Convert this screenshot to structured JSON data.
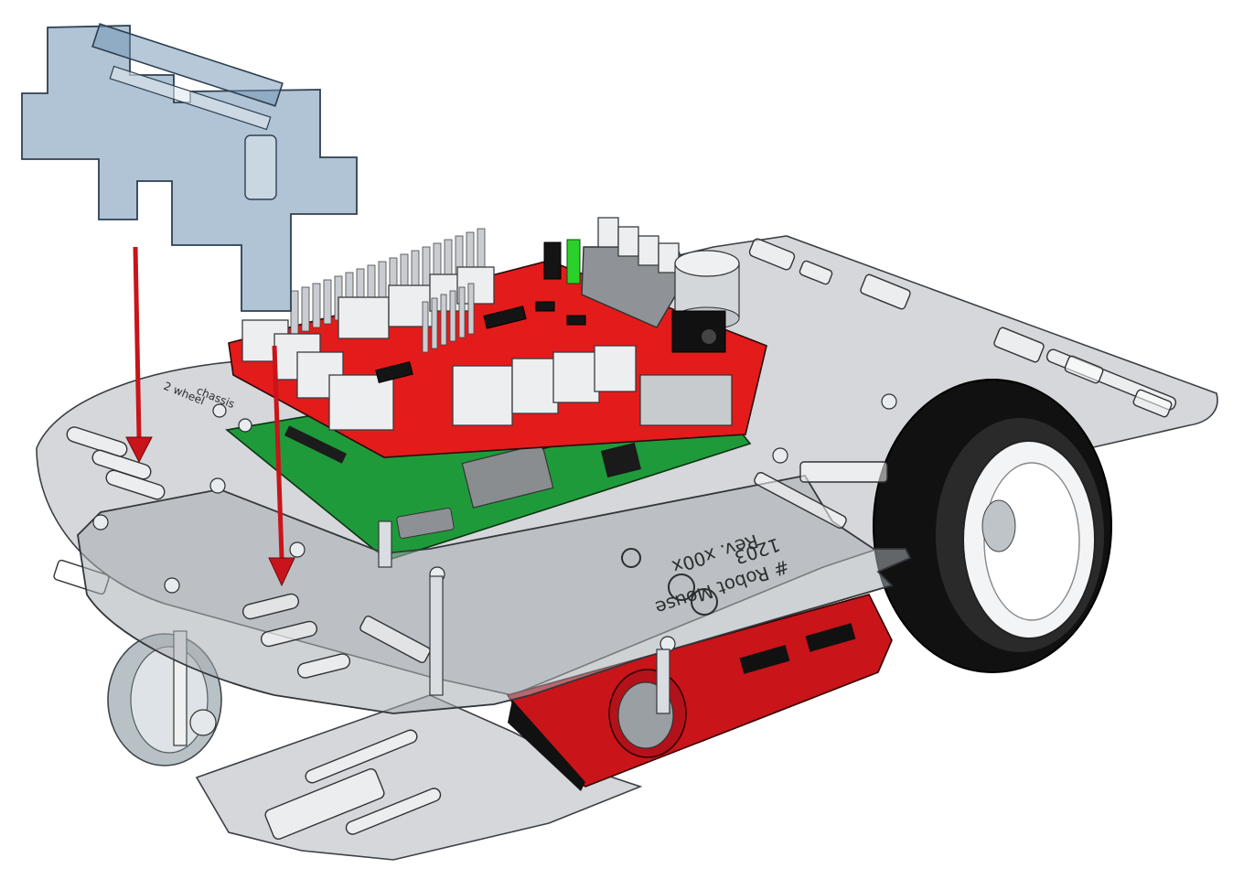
{
  "engraving": {
    "line1": "# Robot Mouse",
    "line2": "1203",
    "line3": "Rev. x00x",
    "small_left_1": "2 wheel",
    "small_left_2": "chassis"
  },
  "colors": {
    "acrylic": "#9aa0a6",
    "top_board": "#e31b1b",
    "main_board": "#1f9a3a",
    "motor_housing": "#d81c1c",
    "tool": "#6f93b3",
    "arrow": "#c8141a",
    "tire": "#111111"
  },
  "icons": [
    "down-arrow-icon",
    "down-arrow-icon"
  ]
}
